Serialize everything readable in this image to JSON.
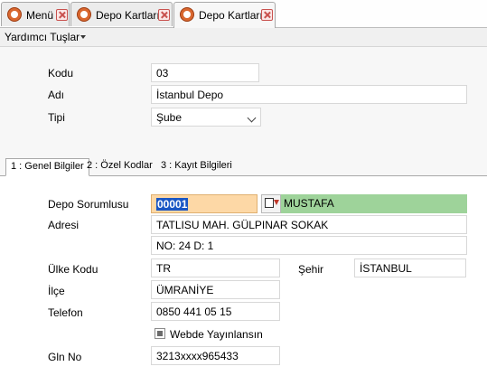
{
  "tabs": [
    {
      "label": "Menü"
    },
    {
      "label": "Depo Kartları"
    },
    {
      "label": "Depo Kartları"
    }
  ],
  "toolbar": {
    "menu_label": "Yardımcı Tuşlar"
  },
  "header": {
    "code_label": "Kodu",
    "code_value": "03",
    "name_label": "Adı",
    "name_value": "İstanbul Depo",
    "type_label": "Tipi",
    "type_value": "Şube"
  },
  "subtabs": [
    {
      "label": "1 : Genel Bilgiler"
    },
    {
      "label": "2 : Özel Kodlar"
    },
    {
      "label": "3 : Kayıt Bilgileri"
    }
  ],
  "general": {
    "manager_label": "Depo Sorumlusu",
    "manager_code": "00001",
    "manager_name": "MUSTAFA",
    "address_label": "Adresi",
    "address_line1": "TATLISU MAH. GÜLPINAR SOKAK",
    "address_line2": "NO: 24 D: 1",
    "country_label": "Ülke Kodu",
    "country_value": "TR",
    "city_label": "Şehir",
    "city_value": "İSTANBUL",
    "district_label": "İlçe",
    "district_value": "ÜMRANİYE",
    "phone_label": "Telefon",
    "phone_value": "0850 441 05 15",
    "web_label": "Webde Yayınlansın",
    "gln_label": "Gln No",
    "gln_value": "3213xxxx965433"
  },
  "icons": {
    "tab_icon": "app-logo-icon",
    "close_icon": "close-icon",
    "lookup_icon": "lookup-icon",
    "dropdown_icon": "chevron-down-icon"
  },
  "colors": {
    "code_field_bg": "#fdd8a6",
    "name_field_bg": "#9ed39a",
    "selection": "#1a56c4",
    "tab_icon": "#d9672f"
  }
}
